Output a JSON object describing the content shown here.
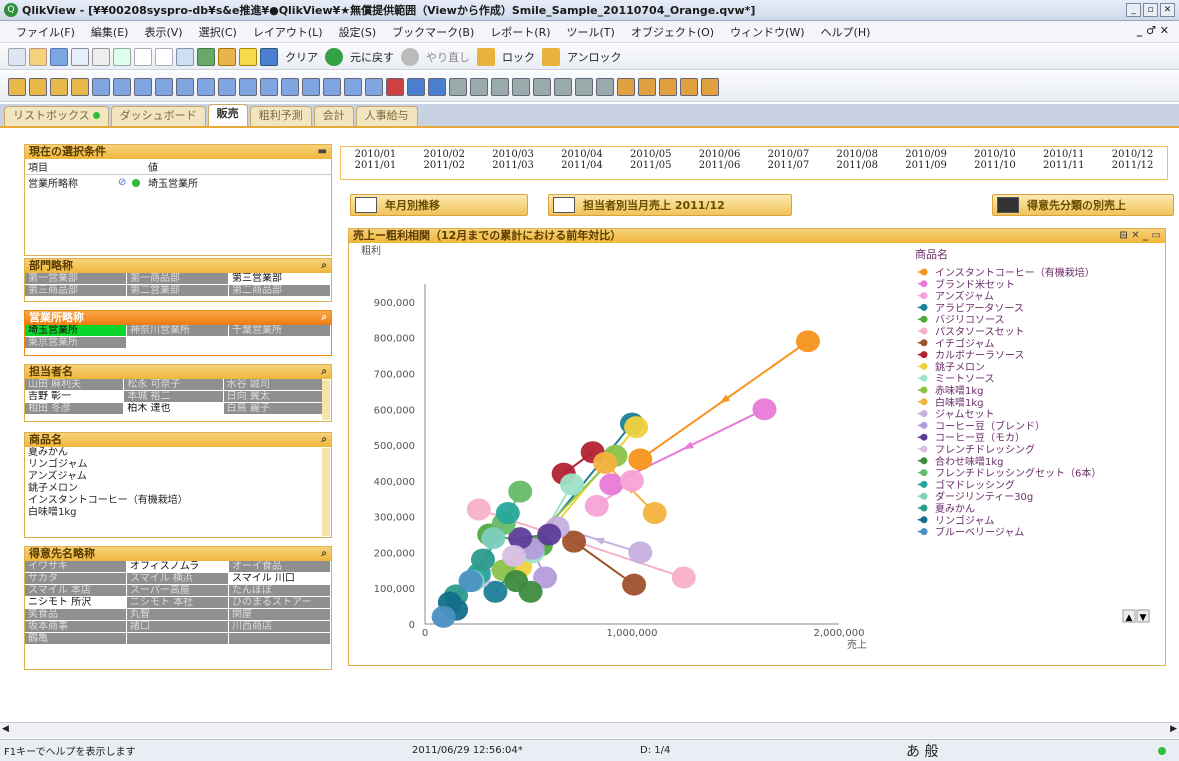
{
  "window": {
    "title": "QlikView - [¥¥00208syspro-db¥s&e推進¥●QlikView¥★無償提供範囲（Viewから作成）Smile_Sample_20110704_Orange.qvw*]",
    "controls": [
      "_",
      "▫",
      "✕"
    ]
  },
  "menu": {
    "items": [
      "ファイル(F)",
      "編集(E)",
      "表示(V)",
      "選択(C)",
      "レイアウト(L)",
      "設定(S)",
      "ブックマーク(B)",
      "レポート(R)",
      "ツール(T)",
      "オブジェクト(O)",
      "ウィンドウ(W)",
      "ヘルプ(H)"
    ],
    "right": "_ ♂ ✕"
  },
  "toolbar1": {
    "clear": "クリア",
    "back": "元に戻す",
    "redo": "やり直し",
    "lock": "ロック",
    "unlock": "アンロック"
  },
  "tabs": [
    {
      "label": "リストボックス"
    },
    {
      "label": "ダッシュボード"
    },
    {
      "label": "販売"
    },
    {
      "label": "粗利予測"
    },
    {
      "label": "会計"
    },
    {
      "label": "人事給与"
    }
  ],
  "current_selections": {
    "title": "現在の選択条件",
    "col_field": "項目",
    "col_value": "値",
    "field": "営業所略称",
    "value": "埼玉営業所"
  },
  "dept": {
    "title": "部門略称",
    "cells": [
      "第一営業部",
      "第一商品部",
      "第三営業部",
      "第三商品部",
      "第二営業部",
      "第二商品部"
    ]
  },
  "office": {
    "title": "営業所略称",
    "cells": [
      "埼玉営業所",
      "神奈川営業所",
      "千葉営業所",
      "東京営業所"
    ]
  },
  "staff": {
    "title": "担当者名",
    "cells": [
      "山田 麻利夫",
      "松永 可奈子",
      "水谷 誠司",
      "吉野 彰一",
      "本城 裕二",
      "日向 翼太",
      "相田 冬彦",
      "柏木 達也",
      "白鳥 麗子"
    ]
  },
  "product_list": {
    "title": "商品名",
    "items": [
      "夏みかん",
      "リンゴジャム",
      "アンズジャム",
      "銚子メロン",
      "インスタントコーヒー（有機栽培）",
      "白味噌1kg"
    ]
  },
  "customer": {
    "title": "得意先名略称",
    "cells": [
      "イワサキ",
      "オフィスノムラ",
      "オーイ食品",
      "サカタ",
      "スマイル 横浜",
      "スマイル 川口",
      "スマイル 本店",
      "スーパー高屋",
      "たんぽぽ",
      "ニシモト 所沢",
      "ニシモト 本社",
      "ひのまるストアー",
      "笑食品",
      "丸智",
      "関屋",
      "坂本商事",
      "諸口",
      "川西商店",
      "鶴亀",
      "",
      ""
    ]
  },
  "months": {
    "row1": [
      "2010/01",
      "2010/02",
      "2010/03",
      "2010/04",
      "2010/05",
      "2010/06",
      "2010/07",
      "2010/08",
      "2010/09",
      "2010/10",
      "2010/11",
      "2010/12"
    ],
    "row2": [
      "2011/01",
      "2011/02",
      "2011/03",
      "2011/04",
      "2011/05",
      "2011/06",
      "2011/07",
      "2011/08",
      "2011/09",
      "2011/10",
      "2011/11",
      "2011/12"
    ]
  },
  "buttons": {
    "monthly": "年月別推移",
    "by_staff": "担当者別当月売上 2011/12",
    "by_customer": "得意先分類の別売上"
  },
  "chart_box": {
    "title": "売上ー粗利相関（12月までの累計における前年対比）",
    "icons": "⊟ ✕ _ ▭"
  },
  "chart_data": {
    "type": "scatter",
    "xlabel": "売上",
    "ylabel": "粗利",
    "xlim": [
      0,
      2000000
    ],
    "ylim": [
      0,
      950000
    ],
    "xticks": [
      0,
      1000000,
      2000000
    ],
    "xtick_labels": [
      "0",
      "1,000,000",
      "2,000,000"
    ],
    "yticks": [
      0,
      100000,
      200000,
      300000,
      400000,
      500000,
      600000,
      700000,
      800000,
      900000
    ],
    "ytick_labels": [
      "0",
      "100,000",
      "200,000",
      "300,000",
      "400,000",
      "500,000",
      "600,000",
      "700,000",
      "800,000",
      "900,000"
    ],
    "legend_title": "商品名",
    "legend_position": "right",
    "series": [
      {
        "name": "インスタントコーヒー（有機栽培）",
        "color": "#f7941d",
        "points": [
          [
            1040000,
            460000
          ],
          [
            1850000,
            790000
          ]
        ],
        "arrow": true
      },
      {
        "name": "ブランド米セット",
        "color": "#e87ad8",
        "points": [
          [
            900000,
            390000
          ],
          [
            1640000,
            600000
          ]
        ],
        "arrow": true
      },
      {
        "name": "アンズジャム",
        "color": "#f5a3d6",
        "points": [
          [
            830000,
            330000
          ],
          [
            1000000,
            400000
          ]
        ]
      },
      {
        "name": "アラビアータソース",
        "color": "#1e7f9a",
        "points": [
          [
            1000000,
            560000
          ],
          [
            340000,
            90000
          ]
        ]
      },
      {
        "name": "バジリコソース",
        "color": "#4fa93d",
        "points": [
          [
            310000,
            250000
          ],
          [
            560000,
            220000
          ]
        ]
      },
      {
        "name": "パスタソースセット",
        "color": "#f8b0c8",
        "points": [
          [
            260000,
            320000
          ],
          [
            1250000,
            130000
          ]
        ]
      },
      {
        "name": "イチゴジャム",
        "color": "#a0522d",
        "points": [
          [
            720000,
            230000
          ],
          [
            1010000,
            110000
          ]
        ]
      },
      {
        "name": "カルボナーラソース",
        "color": "#b22234",
        "points": [
          [
            810000,
            480000
          ],
          [
            670000,
            420000
          ]
        ]
      },
      {
        "name": "銚子メロン",
        "color": "#f2d23c",
        "points": [
          [
            1020000,
            550000
          ],
          [
            460000,
            160000
          ]
        ]
      },
      {
        "name": "ミートソース",
        "color": "#9ee3c8",
        "points": [
          [
            710000,
            390000
          ],
          [
            520000,
            200000
          ]
        ]
      },
      {
        "name": "赤味噌1kg",
        "color": "#8bc34a",
        "points": [
          [
            920000,
            470000
          ],
          [
            380000,
            150000
          ]
        ]
      },
      {
        "name": "白味噌1kg",
        "color": "#f3b33d",
        "points": [
          [
            870000,
            450000
          ],
          [
            1110000,
            310000
          ]
        ],
        "arrow": true
      },
      {
        "name": "ジャムセット",
        "color": "#c5b0e0",
        "points": [
          [
            640000,
            270000
          ],
          [
            1040000,
            200000
          ]
        ],
        "arrow": true
      },
      {
        "name": "コーヒー豆（ブレンド）",
        "color": "#b39ddb",
        "points": [
          [
            520000,
            210000
          ],
          [
            580000,
            130000
          ]
        ]
      },
      {
        "name": "コーヒー豆（モカ）",
        "color": "#5e3c99",
        "points": [
          [
            600000,
            250000
          ],
          [
            460000,
            240000
          ]
        ]
      },
      {
        "name": "フレンチドレッシング",
        "color": "#d8bfe6",
        "points": [
          [
            430000,
            190000
          ],
          [
            260000,
            130000
          ]
        ]
      },
      {
        "name": "合わせ味噌1kg",
        "color": "#3d8c40",
        "points": [
          [
            440000,
            120000
          ],
          [
            510000,
            90000
          ]
        ]
      },
      {
        "name": "フレンチドレッシングセット（6本）",
        "color": "#66bb6a",
        "points": [
          [
            460000,
            370000
          ],
          [
            380000,
            280000
          ]
        ]
      },
      {
        "name": "ゴマドレッシング",
        "color": "#26a69a",
        "points": [
          [
            400000,
            310000
          ],
          [
            260000,
            140000
          ]
        ]
      },
      {
        "name": "ダージリンティー30g",
        "color": "#7dcfc0",
        "points": [
          [
            330000,
            240000
          ],
          [
            230000,
            120000
          ]
        ]
      },
      {
        "name": "夏みかん",
        "color": "#2e9a8c",
        "points": [
          [
            280000,
            180000
          ],
          [
            150000,
            80000
          ]
        ]
      },
      {
        "name": "リンゴジャム",
        "color": "#136f8a",
        "points": [
          [
            150000,
            40000
          ],
          [
            120000,
            60000
          ]
        ]
      },
      {
        "name": "ブルーベリージャム",
        "color": "#4a90c2",
        "points": [
          [
            220000,
            120000
          ],
          [
            90000,
            20000
          ]
        ]
      }
    ]
  },
  "status": {
    "help": "F1キーでヘルプを表示します",
    "datetime": "2011/06/29 12:56:04*",
    "doc": "D: 1/4",
    "ime": "あ 般"
  },
  "colors": {
    "accent": "#f0b63a",
    "tab_bar": "#c8d2e2",
    "selected": "#0bd62b",
    "excluded": "#8f8f8f"
  }
}
